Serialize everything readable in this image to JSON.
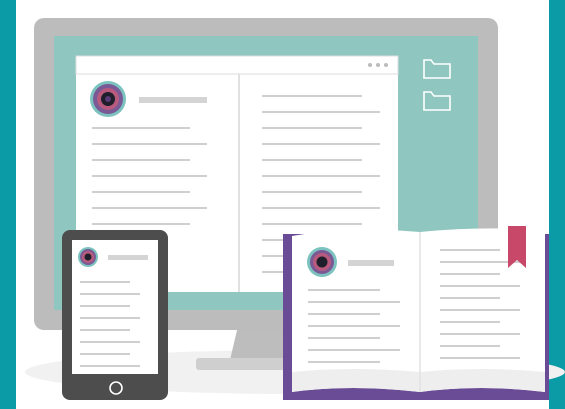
{
  "colors": {
    "frame": "#0a9ba6",
    "background": "#ffffff",
    "monitor_bezel": "#bcbcbc",
    "monitor_stand": "#bdbdbd",
    "screen": "#8fc7c0",
    "window": "#ffffff",
    "text_lines": "#cfcfcf",
    "avatar_outer": "#7a5a96",
    "avatar_mid": "#b75a7e",
    "avatar_inner": "#1f1f2b",
    "avatar_ring": "#7cc3c0",
    "tablet": "#4d4d4d",
    "book_cover": "#6a4c96",
    "bookmark": "#c8486a",
    "shadow": "#f0f0f0"
  },
  "icons": {
    "window_controls": "three-dots-icon",
    "desktop_folders": [
      "folder-icon",
      "folder-icon"
    ],
    "tablet_home": "home-button-icon",
    "profile_avatars": "avatar-icon",
    "bookmark": "bookmark-icon"
  }
}
